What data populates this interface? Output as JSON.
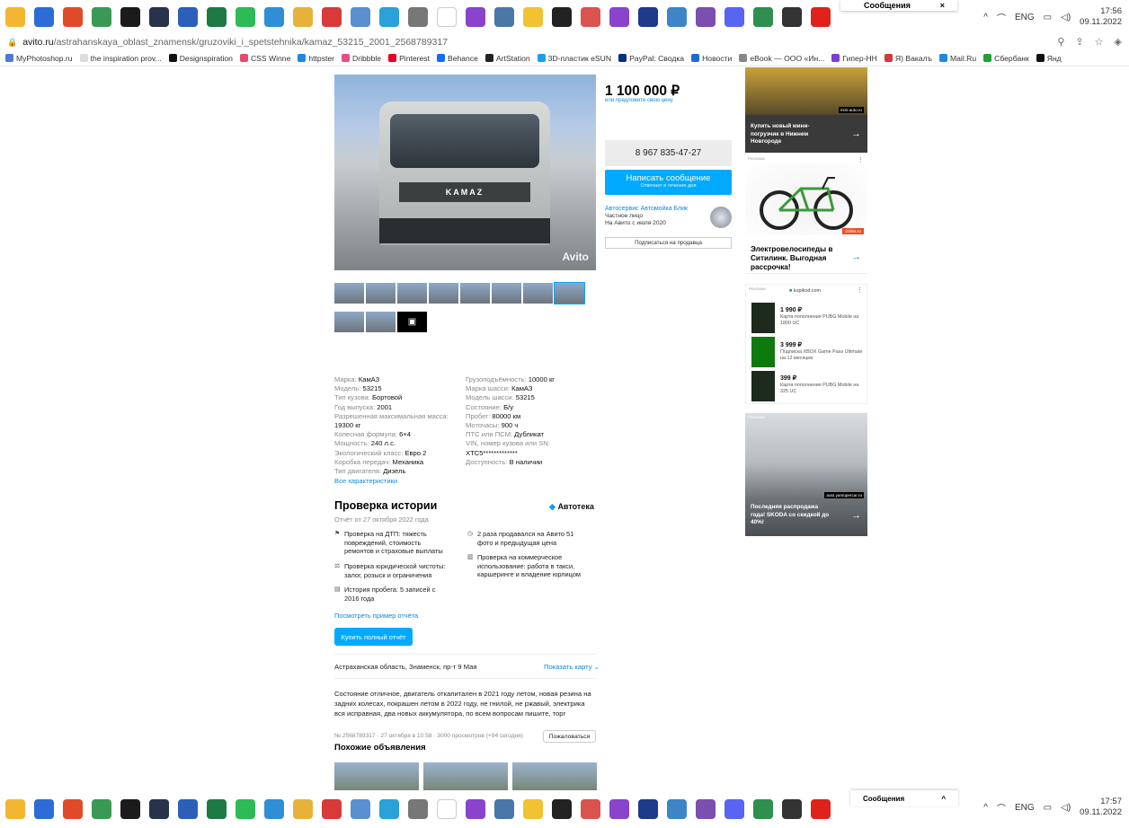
{
  "taskbar_icons": [
    "file-explorer-icon",
    "store-icon",
    "chrome-icon",
    "calculator-icon",
    "nvidia-icon",
    "steam-icon",
    "word-icon",
    "excel-icon",
    "whatsapp-icon",
    "settings-icon",
    "paint-icon",
    "pdf-icon",
    "photos-icon",
    "telegram-icon",
    "scissors-icon",
    "media-icon",
    "obs-icon",
    "vk-icon",
    "notes-icon",
    "corsair-icon",
    "pdf-reader-icon",
    "podcast-icon",
    "photoshop-icon",
    "vpn-icon",
    "vs-icon",
    "discord-icon",
    "maps-icon",
    "search-icon",
    "opera-icon"
  ],
  "tray": {
    "lang": "ENG",
    "time_top": "17:56",
    "date_top": "09.11.2022",
    "time_bottom": "17:57",
    "date_bottom": "09.11.2022"
  },
  "messages_popup": {
    "label": "Сообщения",
    "chevron_top": "^",
    "chevron_bottom": "^"
  },
  "url": {
    "host": "avito.ru",
    "path": "/astrahanskaya_oblast_znamensk/gruzoviki_i_spetstehnika/kamaz_53215_2001_2568789317"
  },
  "bookmarks": [
    "MyPhotoshop.ru",
    "the inspiration prov...",
    "Designspiration",
    "CSS Winne",
    "httpster",
    "Dribbble",
    "Pinterest",
    "Behance",
    "ArtStation",
    "3D-пластик eSUN",
    "PayPal: Сводка",
    "Новости",
    "eBook — ООО «Ин...",
    "Гипер-НН",
    "Я) Вакалъ",
    "Mail.Ru",
    "Сбербанк",
    "Янд"
  ],
  "photo": {
    "brand": "KAMAZ",
    "watermark": "Avito",
    "plate": "Avito"
  },
  "thumbs_extra": "10",
  "specs_left": [
    {
      "k": "Марка:",
      "v": "КамАЗ"
    },
    {
      "k": "Модель:",
      "v": "53215"
    },
    {
      "k": "Тип кузова:",
      "v": "Бортовой"
    },
    {
      "k": "Год выпуска:",
      "v": "2001"
    },
    {
      "k": "Разрешенная максимальная масса:",
      "v": "19300 кг"
    },
    {
      "k": "Колесная формула:",
      "v": "6×4"
    },
    {
      "k": "Мощность:",
      "v": "240 л.с."
    },
    {
      "k": "Экологический класс:",
      "v": "Евро 2"
    },
    {
      "k": "Коробка передач:",
      "v": "Механика"
    },
    {
      "k": "Тип двигателя:",
      "v": "Дизель"
    }
  ],
  "specs_right": [
    {
      "k": "Грузоподъёмность:",
      "v": "10000 кг"
    },
    {
      "k": "Марка шасси:",
      "v": "КамАЗ"
    },
    {
      "k": "Модель шасси:",
      "v": "53215"
    },
    {
      "k": "Состояние:",
      "v": "Б/у"
    },
    {
      "k": "Пробег:",
      "v": "80000 км"
    },
    {
      "k": "Моточасы:",
      "v": "900 ч"
    },
    {
      "k": "ПТС или ПСМ:",
      "v": "Дубликат"
    },
    {
      "k": "VIN, номер кузова или SN:",
      "v": "XTC5*************"
    },
    {
      "k": "Доступность:",
      "v": "В наличии"
    }
  ],
  "all_specs_link": "Все характеристики",
  "history": {
    "title": "Проверка истории",
    "date": "Отчёт от 27 октября 2022 года",
    "brand": "Автотека",
    "items_left": [
      "Проверка на ДТП: тяжесть повреждений, стоимость ремонтов и страховые выплаты",
      "Проверка юридической чистоты: залог, розыск и ограничения",
      "История пробега: 5 записей с 2016 года"
    ],
    "items_right": [
      "2 раза продавался на Авито 51 фото и предыдущая цена",
      "Проверка на коммерческое использование: работа в такси, каршеринге и владение юрлицом"
    ],
    "sample_link": "Посмотреть пример отчёта",
    "buy_button": "Купить полный отчёт"
  },
  "address": "Астраханская область, Знаменск, пр-т 9 Мая",
  "show_map": "Показать карту",
  "description": "Состояние отличное, двигатель откапитален в 2021 году летом, новая резина на задних колесах, покрашен летом в 2022 году, не гнилой, не ржавый, электрика вся исправная, два новых аккумулятора, по всем вопросам пишите, торг",
  "meta": "№ 2568789317 · 27 октября в 10:58 · 3000 просмотров (+94 сегодня)",
  "complain_button": "Пожаловаться",
  "similar_title": "Похожие объявления",
  "price": "1 100 000 ₽",
  "offer_link": "или предложите свою цену",
  "phone": "8 967 835-47-27",
  "write_button": {
    "label": "Написать сообщение",
    "sub": "Отвечает в течение дня"
  },
  "seller": {
    "name": "Автосервис Автомойка Блик",
    "type": "Частное лицо",
    "since": "На Авито с июля 2020"
  },
  "subscribe_button": "Подписаться на продавца",
  "ads": {
    "ad1": {
      "text": "Купить новый мини-погрузчик в Нижнем Новгороде",
      "domain": "mini-auto.ru"
    },
    "ad2": {
      "label": "РЕКЛАМА",
      "text": "Электровелосипеды в Ситилинк. Выгодная рассрочка!",
      "domain": "citilink.ru"
    },
    "ad3": {
      "label": "РЕКЛАМА",
      "domain": "kupikod.com",
      "items": [
        {
          "price": "1 990 ₽",
          "desc": "Карта пополнения PUBG Mobile на 1800 UC"
        },
        {
          "price": "3 999 ₽",
          "desc": "Подписка XBOX Game Pass Ultimate на 12 месяцев"
        },
        {
          "price": "399 ₽",
          "desc": "Карта пополнения PUBG Mobile на 325 UC"
        }
      ]
    },
    "ad4": {
      "label": "РЕКЛАМА",
      "text": "Последняя распродажа года! SKODA со скидкой до 40%!",
      "domain": "auto.yarsupercar.ru"
    }
  }
}
